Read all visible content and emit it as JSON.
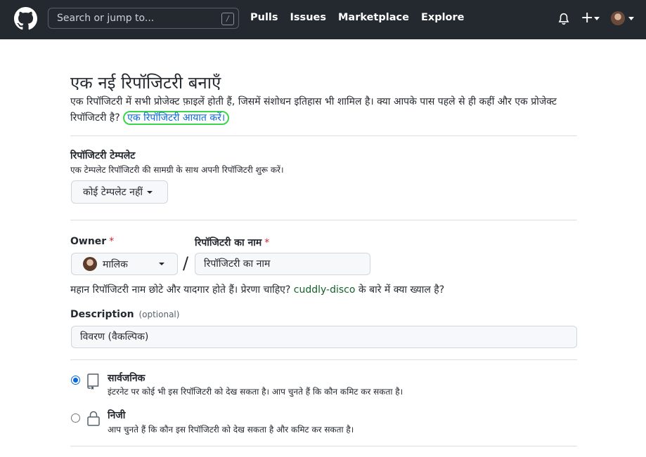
{
  "header": {
    "search_placeholder": "Search or jump to...",
    "search_shortcut": "/",
    "nav": [
      "Pulls",
      "Issues",
      "Marketplace",
      "Explore"
    ],
    "plus_symbol": "+",
    "icons": [
      "github-logo",
      "bell-icon",
      "plus-icon",
      "avatar"
    ]
  },
  "page": {
    "title": "एक नई रिपॉजिटरी बनाएँ",
    "intro_text": "एक रिपॉजिटरी में सभी प्रोजेक्ट फ़ाइलें होती हैं, जिसमें संशोधन इतिहास भी शामिल है। क्या आपके पास पहले से ही कहीं और एक प्रोजेक्ट रिपॉजिटरी है?",
    "import_link": "एक रिपॉजिटरी आयात करें।"
  },
  "template": {
    "label": "रिपॉजिटरी टेम्पलेट",
    "description": "एक टेम्पलेट रिपॉजिटरी की सामग्री के साथ अपनी रिपॉजिटरी शुरू करें।",
    "button_label": "कोई टेम्पलेट नहीं"
  },
  "owner": {
    "label": "Owner",
    "required_mark": "*",
    "selected": "मालिक"
  },
  "repo_name": {
    "label": "रिपॉजिटरी का नाम",
    "required_mark": "*",
    "placeholder": "रिपॉजिटरी का नाम",
    "separator": "/"
  },
  "hint": {
    "prefix": "महान रिपॉजिटरी नाम छोटे और यादगार होते हैं। प्रेरणा चाहिए?",
    "suggestion": "cuddly-disco",
    "suffix": "के बारे में क्या ख्याल है?"
  },
  "description": {
    "label": "Description",
    "optional": "(optional)",
    "placeholder": "विवरण (वैकल्पिक)"
  },
  "visibility": {
    "public": {
      "title": "सार्वजनिक",
      "desc": "इंटरनेट पर कोई भी इस रिपॉजिटरी को देख सकता है। आप चुनते हैं कि कौन कमिट कर सकता है।",
      "selected": true
    },
    "private": {
      "title": "निजी",
      "desc": "आप चुनते हैं कि कौन इस रिपॉजिटरी को देख सकता है और कमिट कर सकता है।",
      "selected": false
    }
  },
  "colors": {
    "header_bg": "#24292f",
    "link": "#0969da",
    "highlight_circle": "#3cd64b",
    "suggestion": "#116329",
    "required": "#cf222e"
  }
}
